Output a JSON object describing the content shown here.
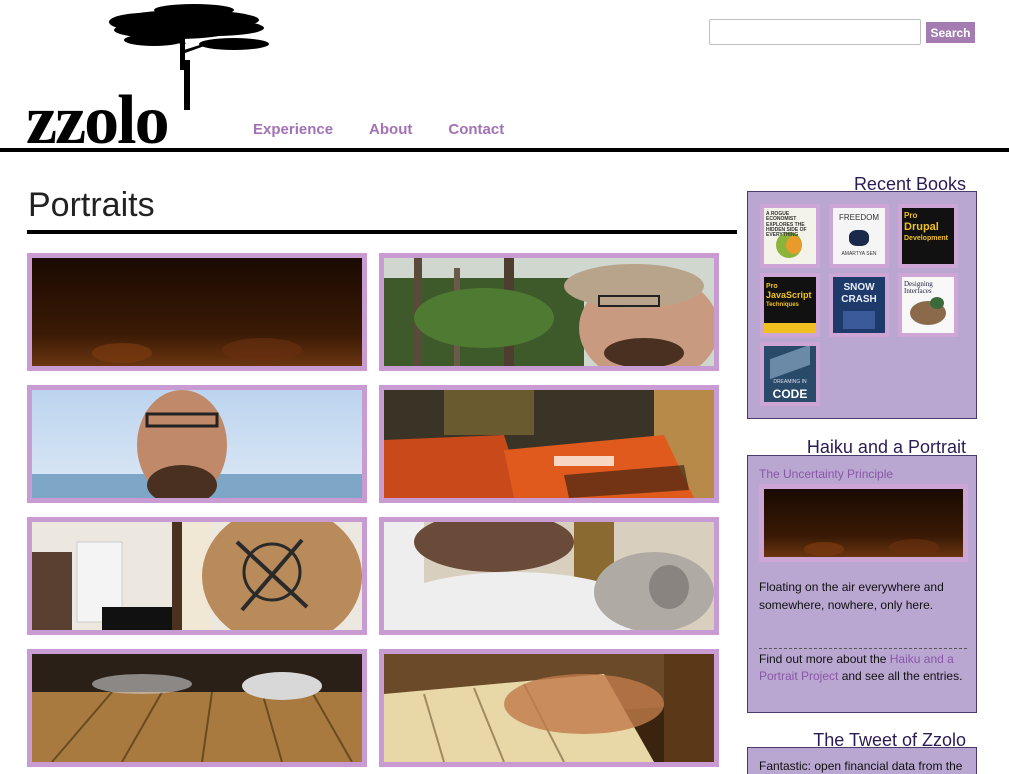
{
  "site": {
    "logo_text": "zzolo",
    "nav": [
      "Experience",
      "About",
      "Contact"
    ]
  },
  "search": {
    "value": "",
    "placeholder": "",
    "button_label": "Search"
  },
  "main": {
    "title": "Portraits",
    "thumbnails": [
      "dark-fireplace-glow",
      "man-with-cap-plants",
      "man-smiling-sky-sea",
      "magazines-economist",
      "tattoo-on-arm",
      "man-holding-cat",
      "feet-wooden-floor",
      "hands-on-piano-keys"
    ]
  },
  "sidebar": {
    "recent_books": {
      "heading": "Recent Books",
      "books": [
        {
          "title": "A Rogue Economist Explores the Hidden Side of Everything"
        },
        {
          "title": "As Freedom"
        },
        {
          "title": "Pro Drupal Development"
        },
        {
          "title": "Pro JavaScript Techniques"
        },
        {
          "title": "Snow Crash"
        },
        {
          "title": "Designing Interfaces"
        },
        {
          "title": "Dreaming in Code"
        }
      ]
    },
    "haiku": {
      "heading": "Haiku and a Portrait",
      "entry_title": "The Uncertainty Principle",
      "poem": "Floating on the air everywhere and somewhere, nowhere, only here.",
      "more_prefix": "Find out more about the ",
      "more_link": "Haiku and a Portrait Project",
      "more_suffix": " and see all the entries."
    },
    "tweet": {
      "heading": "The Tweet of Zzolo",
      "text": "Fantastic: open financial data from the"
    }
  },
  "colors": {
    "accent": "#a372b4",
    "thumb_border": "#c89bd2",
    "sidebar_bg": "#b9a6d1",
    "heading_dark": "#2d1b54"
  }
}
